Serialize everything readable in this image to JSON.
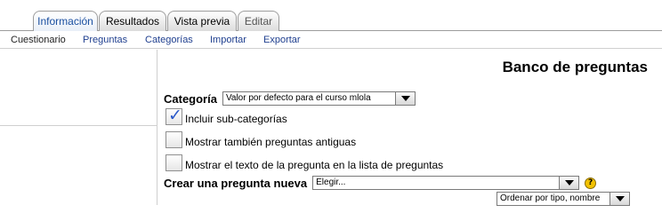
{
  "tabs": [
    {
      "label": "Información",
      "state": "active"
    },
    {
      "label": "Resultados",
      "state": "normal"
    },
    {
      "label": "Vista previa",
      "state": "normal"
    },
    {
      "label": "Editar",
      "state": "disabled"
    }
  ],
  "subtabs": [
    {
      "label": "Cuestionario",
      "current": true
    },
    {
      "label": "Preguntas",
      "current": false
    },
    {
      "label": "Categorías",
      "current": false
    },
    {
      "label": "Importar",
      "current": false
    },
    {
      "label": "Exportar",
      "current": false
    }
  ],
  "main": {
    "title": "Banco de preguntas",
    "category_label": "Categoría",
    "category_value": "Valor por defecto para el curso mlola",
    "options": [
      {
        "label": "Incluir sub-categorías",
        "checked": true
      },
      {
        "label": "Mostrar también preguntas antiguas",
        "checked": false
      },
      {
        "label": "Mostrar el texto de la pregunta en la lista de preguntas",
        "checked": false
      }
    ],
    "new_question_label": "Crear una pregunta nueva",
    "new_question_value": "Elegir...",
    "help_icon_glyph": "?",
    "sort_value": "Ordenar por tipo, nombre"
  },
  "colors": {
    "link": "#1f3f8f",
    "active_tab_text": "#1a4fa0",
    "check_mark": "#2a58c9",
    "help_icon": "#f3c200"
  },
  "icons": {
    "help": "help-icon",
    "dropdown": "chevron-down-icon",
    "check": "checkmark-icon"
  }
}
